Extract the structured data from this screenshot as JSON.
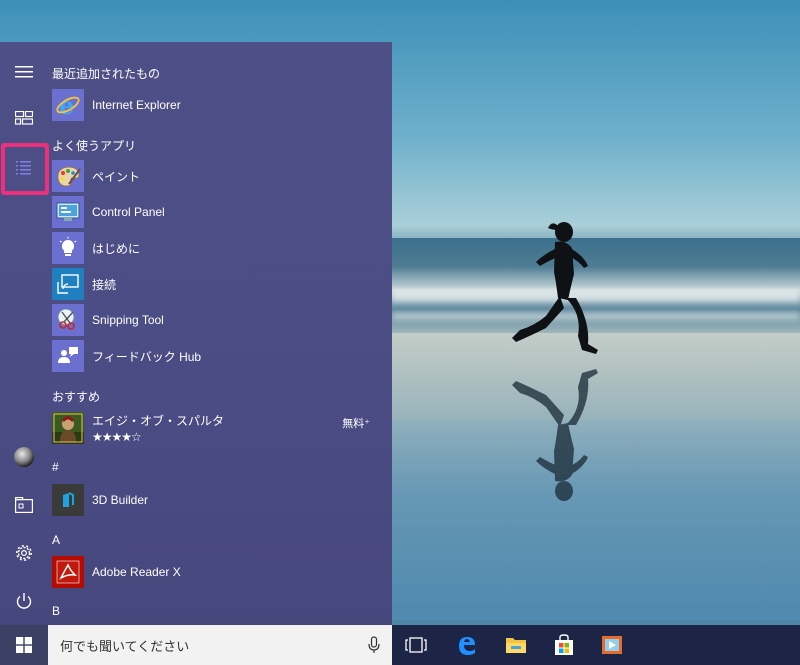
{
  "start_menu": {
    "recently_added": {
      "header": "最近追加されたもの",
      "items": [
        {
          "label": "Internet Explorer",
          "icon": "internet-explorer-icon"
        }
      ]
    },
    "most_used": {
      "header": "よく使うアプリ",
      "items": [
        {
          "label": "ペイント",
          "icon": "paint-icon"
        },
        {
          "label": "Control Panel",
          "icon": "control-panel-icon"
        },
        {
          "label": "はじめに",
          "icon": "get-started-icon"
        },
        {
          "label": "接続",
          "icon": "connect-icon"
        },
        {
          "label": "Snipping Tool",
          "icon": "snipping-tool-icon"
        },
        {
          "label": "フィードバック Hub",
          "icon": "feedback-hub-icon"
        }
      ]
    },
    "suggested": {
      "header": "おすすめ",
      "item": {
        "title": "エイジ・オブ・スパルタ",
        "rating_text": "★★★★☆",
        "rating": 4.5,
        "price": "無料⁺",
        "icon": "age-of-sparta-icon"
      }
    },
    "groups": [
      {
        "letter": "#",
        "items": [
          {
            "label": "3D Builder",
            "icon": "3d-builder-icon"
          }
        ]
      },
      {
        "letter": "A",
        "items": [
          {
            "label": "Adobe Reader X",
            "icon": "adobe-reader-icon"
          }
        ]
      },
      {
        "letter": "B",
        "items": []
      }
    ],
    "rail": [
      "hamburger-menu-icon",
      "tiles-icon",
      "all-apps-list-icon",
      "user-avatar-icon",
      "file-explorer-icon",
      "settings-gear-icon",
      "power-icon"
    ]
  },
  "taskbar": {
    "search_placeholder": "何でも聞いてください",
    "icons": [
      "windows-start-icon",
      "microphone-icon",
      "task-view-icon",
      "edge-icon",
      "file-explorer-icon",
      "store-icon",
      "media-player-icon"
    ]
  },
  "colors": {
    "menu_bg": "#4e4f86",
    "taskbar_bg": "#1d2547",
    "highlight_border": "#ee2f7c",
    "tile_blue": "#6b6fd0"
  }
}
